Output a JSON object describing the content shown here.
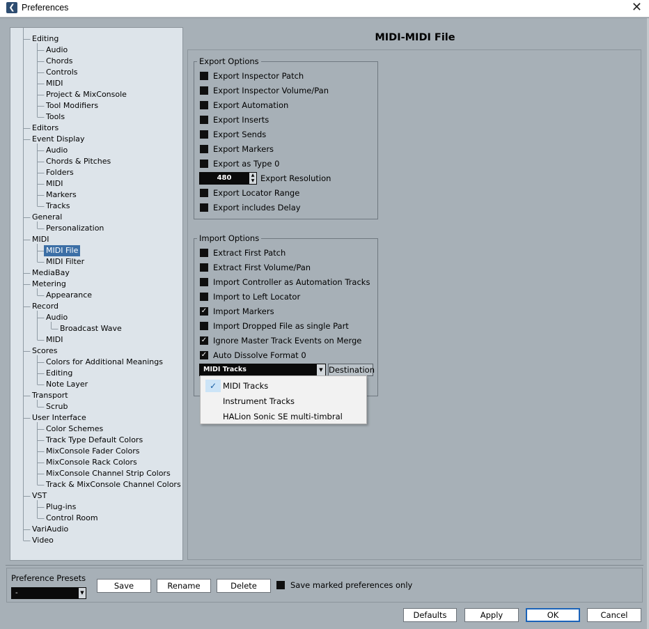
{
  "window": {
    "title": "Preferences",
    "logo_glyph": "❮",
    "close_glyph": "✕"
  },
  "tree": {
    "selected": "MIDI File",
    "items": [
      {
        "label": "Editing",
        "level": 0
      },
      {
        "label": "Audio",
        "level": 1
      },
      {
        "label": "Chords",
        "level": 1
      },
      {
        "label": "Controls",
        "level": 1
      },
      {
        "label": "MIDI",
        "level": 1
      },
      {
        "label": "Project & MixConsole",
        "level": 1
      },
      {
        "label": "Tool Modifiers",
        "level": 1
      },
      {
        "label": "Tools",
        "level": 1
      },
      {
        "label": "Editors",
        "level": 0
      },
      {
        "label": "Event Display",
        "level": 0
      },
      {
        "label": "Audio",
        "level": 1
      },
      {
        "label": "Chords & Pitches",
        "level": 1
      },
      {
        "label": "Folders",
        "level": 1
      },
      {
        "label": "MIDI",
        "level": 1
      },
      {
        "label": "Markers",
        "level": 1
      },
      {
        "label": "Tracks",
        "level": 1
      },
      {
        "label": "General",
        "level": 0
      },
      {
        "label": "Personalization",
        "level": 1
      },
      {
        "label": "MIDI",
        "level": 0
      },
      {
        "label": "MIDI File",
        "level": 1
      },
      {
        "label": "MIDI Filter",
        "level": 1
      },
      {
        "label": "MediaBay",
        "level": 0
      },
      {
        "label": "Metering",
        "level": 0
      },
      {
        "label": "Appearance",
        "level": 1
      },
      {
        "label": "Record",
        "level": 0
      },
      {
        "label": "Audio",
        "level": 1
      },
      {
        "label": "Broadcast Wave",
        "level": 2
      },
      {
        "label": "MIDI",
        "level": 1
      },
      {
        "label": "Scores",
        "level": 0
      },
      {
        "label": "Colors for Additional Meanings",
        "level": 1
      },
      {
        "label": "Editing",
        "level": 1
      },
      {
        "label": "Note Layer",
        "level": 1
      },
      {
        "label": "Transport",
        "level": 0
      },
      {
        "label": "Scrub",
        "level": 1
      },
      {
        "label": "User Interface",
        "level": 0
      },
      {
        "label": "Color Schemes",
        "level": 1
      },
      {
        "label": "Track Type Default Colors",
        "level": 1
      },
      {
        "label": "MixConsole Fader Colors",
        "level": 1
      },
      {
        "label": "MixConsole Rack Colors",
        "level": 1
      },
      {
        "label": "MixConsole Channel Strip Colors",
        "level": 1
      },
      {
        "label": "Track & MixConsole Channel Colors",
        "level": 1
      },
      {
        "label": "VST",
        "level": 0
      },
      {
        "label": "Plug-ins",
        "level": 1
      },
      {
        "label": "Control Room",
        "level": 1
      },
      {
        "label": "VariAudio",
        "level": 0
      },
      {
        "label": "Video",
        "level": 0
      }
    ]
  },
  "page": {
    "title": "MIDI-MIDI File"
  },
  "export_options": {
    "title": "Export Options",
    "items": [
      {
        "label": "Export Inspector Patch",
        "checked": false
      },
      {
        "label": "Export Inspector Volume/Pan",
        "checked": false
      },
      {
        "label": "Export Automation",
        "checked": false
      },
      {
        "label": "Export Inserts",
        "checked": false
      },
      {
        "label": "Export Sends",
        "checked": false
      },
      {
        "label": "Export Markers",
        "checked": false
      },
      {
        "label": "Export as Type 0",
        "checked": false
      },
      {
        "label": "Export Locator Range",
        "checked": false
      },
      {
        "label": "Export includes Delay",
        "checked": false
      }
    ],
    "resolution": {
      "value": "480",
      "label": "Export Resolution"
    }
  },
  "import_options": {
    "title": "Import Options",
    "items": [
      {
        "label": "Extract First Patch",
        "checked": false
      },
      {
        "label": "Extract First Volume/Pan",
        "checked": false
      },
      {
        "label": "Import Controller as Automation Tracks",
        "checked": false
      },
      {
        "label": "Import to Left Locator",
        "checked": false
      },
      {
        "label": "Import Markers",
        "checked": true
      },
      {
        "label": "Import Dropped File as single Part",
        "checked": false
      },
      {
        "label": "Ignore Master Track Events on Merge",
        "checked": true
      },
      {
        "label": "Auto Dissolve Format 0",
        "checked": true
      }
    ],
    "destination": {
      "value": "MIDI Tracks",
      "button_label": "Destination",
      "options": [
        "MIDI Tracks",
        "Instrument Tracks",
        "HALion Sonic SE multi-timbral"
      ],
      "selected_index": 0
    }
  },
  "presets": {
    "label": "Preference Presets",
    "value": "-",
    "save_label": "Save",
    "rename_label": "Rename",
    "delete_label": "Delete",
    "save_marked_label": "Save marked preferences only",
    "save_marked_checked": false
  },
  "footer": {
    "defaults_label": "Defaults",
    "apply_label": "Apply",
    "ok_label": "OK",
    "cancel_label": "Cancel"
  },
  "colors": {
    "background": "#a7b0b7",
    "tree_background": "#dde4ea",
    "selection": "#3c6fa6",
    "primary_button_border": "#1a62b8"
  }
}
